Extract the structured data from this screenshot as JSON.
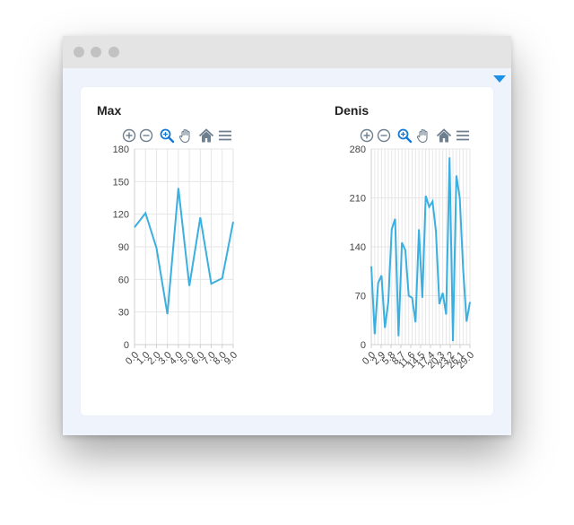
{
  "window": {
    "panel_toggle_icon": "caret-down-icon",
    "accent_color": "#1e90e6"
  },
  "charts": [
    {
      "id": "max",
      "title": "Max",
      "toolbar": [
        "zoom-in-icon",
        "zoom-out-icon",
        "zoom-select-icon",
        "pan-hand-icon",
        "home-icon",
        "menu-icon"
      ],
      "active_tool": "zoom-select-icon",
      "yticks": [
        "180",
        "150",
        "120",
        "90",
        "60",
        "30",
        "0"
      ],
      "xticks": [
        "0.0",
        "1.0",
        "2.0",
        "3.0",
        "4.0",
        "5.0",
        "6.0",
        "7.0",
        "8.0",
        "9.0"
      ]
    },
    {
      "id": "denis",
      "title": "Denis",
      "toolbar": [
        "zoom-in-icon",
        "zoom-out-icon",
        "zoom-select-icon",
        "pan-hand-icon",
        "home-icon",
        "menu-icon"
      ],
      "active_tool": "zoom-select-icon",
      "yticks": [
        "280",
        "210",
        "140",
        "70",
        "0"
      ],
      "xticks": [
        "0.0",
        "2.9",
        "5.8",
        "8.7",
        "11.6",
        "14.5",
        "17.4",
        "20.3",
        "23.2",
        "26.1",
        "29.0"
      ]
    }
  ],
  "chart_data": [
    {
      "type": "line",
      "title": "Max",
      "xlabel": "",
      "ylabel": "",
      "x": [
        0,
        1,
        2,
        3,
        4,
        5,
        6,
        7,
        8,
        9
      ],
      "series": [
        {
          "values": [
            108,
            121,
            89,
            28,
            144,
            54,
            117,
            56,
            61,
            113
          ]
        }
      ],
      "xlim": [
        0,
        9
      ],
      "ylim": [
        0,
        180
      ],
      "line_color": "#3aafe0",
      "grid": true,
      "legend": "none"
    },
    {
      "type": "line",
      "title": "Denis",
      "xlabel": "",
      "ylabel": "",
      "x": [
        0,
        1,
        2,
        3,
        4,
        5,
        6,
        7,
        8,
        9,
        10,
        11,
        12,
        13,
        14,
        15,
        16,
        17,
        18,
        19,
        20,
        21,
        22,
        23,
        24,
        25,
        26,
        27,
        28,
        29
      ],
      "series": [
        {
          "values": [
            112,
            15,
            88,
            99,
            24,
            62,
            165,
            180,
            12,
            146,
            135,
            70,
            67,
            32,
            165,
            67,
            213,
            197,
            205,
            162,
            58,
            74,
            43,
            268,
            5,
            242,
            210,
            108,
            33,
            61
          ]
        }
      ],
      "xlim": [
        0,
        29
      ],
      "ylim": [
        0,
        280
      ],
      "line_color": "#3aafe0",
      "grid": true,
      "legend": "none"
    }
  ]
}
